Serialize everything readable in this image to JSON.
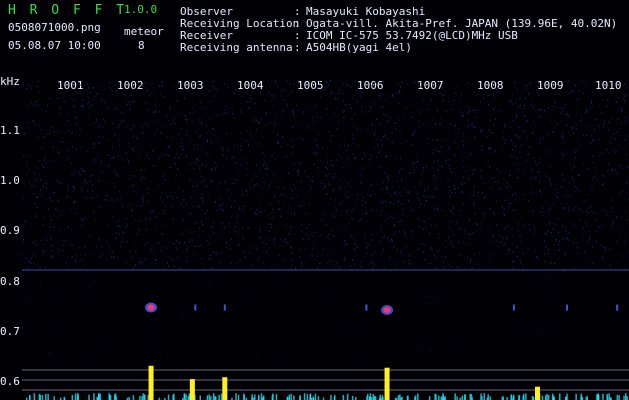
{
  "header": {
    "title": "H R O F F T",
    "version": "1.0.0",
    "filename": "0508071000.png",
    "datetime": "05.08.07 10:00",
    "meteor_label": "meteor",
    "meteor_count": "8"
  },
  "observer": {
    "rows": [
      {
        "key": "Observer",
        "sep": ":",
        "value": "Masayuki Kobayashi"
      },
      {
        "key": "Receiving Location",
        "sep": ":",
        "value": "Ogata-vill. Akita-Pref. JAPAN (139.96E, 40.02N)"
      },
      {
        "key": "Receiver",
        "sep": ":",
        "value": "ICOM IC-575 53.7492(@LCD)MHz USB"
      },
      {
        "key": "Receiving antenna",
        "sep": ":",
        "value": "A504HB(yagi 4el)"
      }
    ]
  },
  "axes": {
    "y_unit": "kHz",
    "y_ticks": [
      "1.1",
      "1.0",
      "0.9",
      "0.8",
      "0.7",
      "0.6"
    ],
    "x_ticks": [
      "1001",
      "1002",
      "1003",
      "1004",
      "1005",
      "1006",
      "1007",
      "1008",
      "1009",
      "1010"
    ]
  },
  "colors": {
    "noise": "#2a2a8a",
    "signal_blue": "#4466ff",
    "signal_hot": "#ff3366",
    "bar_yellow": "#ffee22",
    "bar_cyan": "#22ddee",
    "ref_line": "#8888aa"
  },
  "chart_data": {
    "type": "heatmap",
    "x_range_minutes": [
      1000,
      1010
    ],
    "y_range_khz": [
      0.55,
      1.2
    ],
    "reference_line_khz": 0.82,
    "meteor_echoes": [
      {
        "time": 1001.95,
        "freq_khz": 0.745,
        "strength": "strong"
      },
      {
        "time": 1002.7,
        "freq_khz": 0.745,
        "strength": "weak"
      },
      {
        "time": 1003.2,
        "freq_khz": 0.745,
        "strength": "weak"
      },
      {
        "time": 1005.6,
        "freq_khz": 0.745,
        "strength": "weak"
      },
      {
        "time": 1005.95,
        "freq_khz": 0.74,
        "strength": "strong"
      },
      {
        "time": 1008.1,
        "freq_khz": 0.745,
        "strength": "weak"
      },
      {
        "time": 1009.0,
        "freq_khz": 0.745,
        "strength": "weak"
      },
      {
        "time": 1009.85,
        "freq_khz": 0.745,
        "strength": "weak"
      }
    ],
    "activity_bars": [
      {
        "time": 1001.95,
        "level": 0.9
      },
      {
        "time": 1002.65,
        "level": 0.55
      },
      {
        "time": 1003.2,
        "level": 0.6
      },
      {
        "time": 1005.95,
        "level": 0.85
      },
      {
        "time": 1008.5,
        "level": 0.35
      }
    ]
  }
}
